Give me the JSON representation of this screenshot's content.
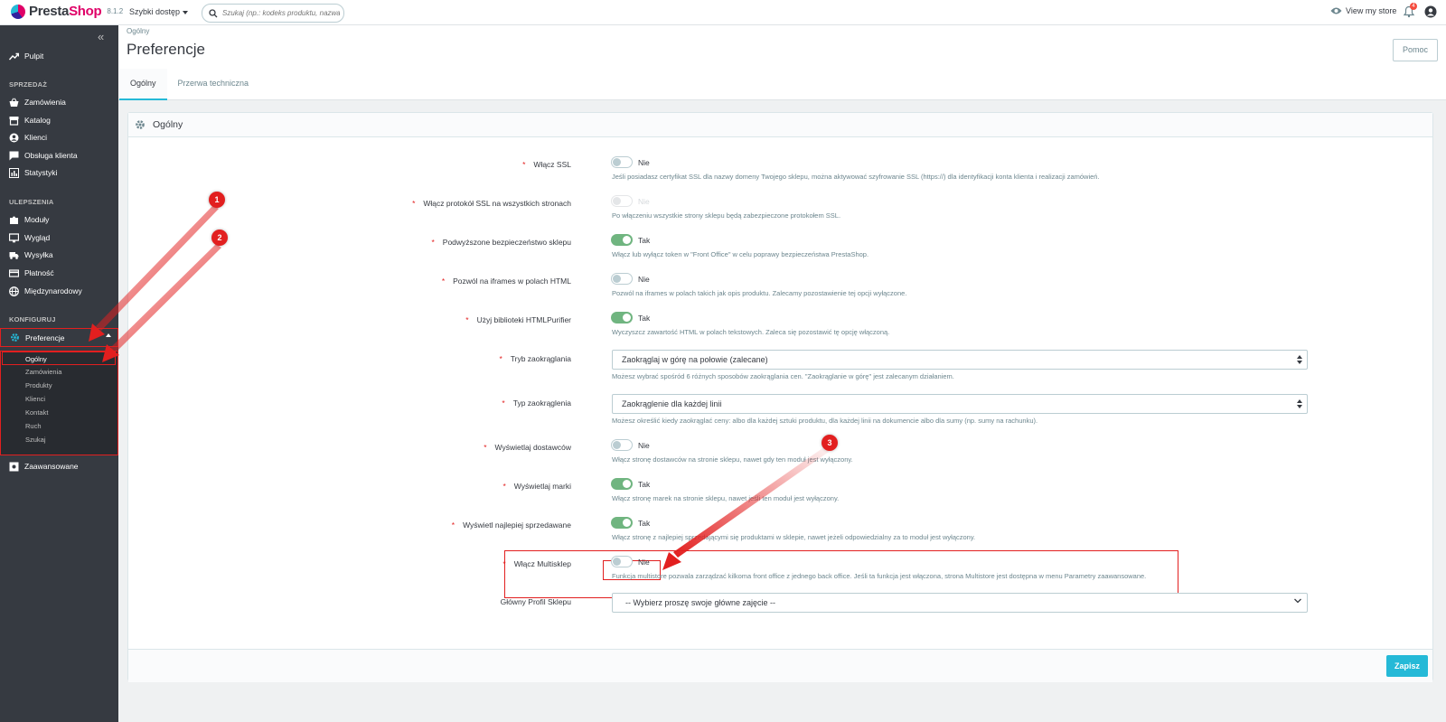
{
  "header": {
    "logo_text_a": "Presta",
    "logo_text_b": "Shop",
    "version": "8.1.2",
    "quick_access": "Szybki dostęp",
    "search_placeholder": "Szukaj (np.: kodeks produktu, nazwa kl",
    "view_store": "View my store",
    "notifications_count": "4"
  },
  "sidebar": {
    "dashboard": "Pulpit",
    "section_sell": "SPRZEDAŻ",
    "orders": "Zamówienia",
    "catalog": "Katalog",
    "customers": "Klienci",
    "customer_service": "Obsługa klienta",
    "stats": "Statystyki",
    "section_improve": "ULEPSZENIA",
    "modules": "Moduły",
    "design": "Wygląd",
    "shipping": "Wysyłka",
    "payment": "Płatność",
    "international": "Międzynarodowy",
    "section_configure": "KONFIGURUJ",
    "preferences": "Preferencje",
    "sub": [
      "Ogólny",
      "Zamówienia",
      "Produkty",
      "Klienci",
      "Kontakt",
      "Ruch",
      "Szukaj"
    ],
    "advanced": "Zaawansowane"
  },
  "page": {
    "breadcrumb": "Ogólny",
    "title": "Preferencje",
    "help": "Pomoc",
    "tabs": [
      "Ogólny",
      "Przerwa techniczna"
    ]
  },
  "card": {
    "title": "Ogólny",
    "save": "Zapisz",
    "rows": [
      {
        "label": "Włącz SSL",
        "value": "Nie",
        "help": "Jeśli posiadasz certyfikat SSL dla nazwy domeny Twojego sklepu, można aktywować szyfrowanie SSL (https://) dla identyfikacji konta klienta i realizacji zamówień."
      },
      {
        "label": "Włącz protokół SSL na wszystkich stronach",
        "value": "Nie",
        "help": "Po włączeniu wszystkie strony sklepu będą zabezpieczone protokołem SSL."
      },
      {
        "label": "Podwyższone bezpieczeństwo sklepu",
        "value": "Tak",
        "help": "Włącz lub wyłącz token w \"Front Office\" w celu poprawy bezpieczeństwa PrestaShop."
      },
      {
        "label": "Pozwól na iframes w polach HTML",
        "value": "Nie",
        "help": "Pozwól na iframes w polach takich jak opis produktu. Zalecamy pozostawienie tej opcji wyłączone."
      },
      {
        "label": "Użyj biblioteki HTMLPurifier",
        "value": "Tak",
        "help": "Wyczyszcz zawartość HTML w polach tekstowych. Zaleca się pozostawić tę opcję włączoną."
      },
      {
        "label": "Tryb zaokrąglania",
        "value": "Zaokrąglaj w górę na połowie (zalecane)",
        "help": "Możesz wybrać spośród 6 różnych sposobów zaokrąglania cen. \"Zaokrąglanie w górę\" jest zalecanym działaniem."
      },
      {
        "label": "Typ zaokrąglenia",
        "value": "Zaokrąglenie dla każdej linii",
        "help": "Możesz określić kiedy zaokrąglać ceny: albo dla każdej sztuki produktu, dla każdej linii na dokumencie albo dla sumy (np. sumy na rachunku)."
      },
      {
        "label": "Wyświetlaj dostawców",
        "value": "Nie",
        "help": "Włącz stronę dostawców na stronie sklepu, nawet gdy ten moduł jest wyłączony."
      },
      {
        "label": "Wyświetlaj marki",
        "value": "Tak",
        "help": "Włącz stronę marek na stronie sklepu, nawet jeśli ten moduł jest wyłączony."
      },
      {
        "label": "Wyświetl najlepiej sprzedawane",
        "value": "Tak",
        "help": "Włącz stronę z najlepiej sprzedającymi się produktami w sklepie, nawet jeżeli odpowiedzialny za to moduł jest wyłączony."
      },
      {
        "label": "Włącz Multisklep",
        "value": "Nie",
        "help": "Funkcja multistore pozwala zarządzać kilkoma front office z jednego back office. Jeśli ta funkcja jest włączona, strona Multistore jest dostępna w menu Parametry zaawansowane."
      },
      {
        "label": "Główny Profil Sklepu",
        "value": "-- Wybierz proszę swoje główne zajęcie --",
        "help": ""
      }
    ]
  },
  "annotations": [
    "1",
    "2",
    "3"
  ],
  "colors": {
    "accent": "#25b9d7",
    "switch_on": "#70b580",
    "annotation": "#e21f1f",
    "sidebar": "#363a41"
  }
}
